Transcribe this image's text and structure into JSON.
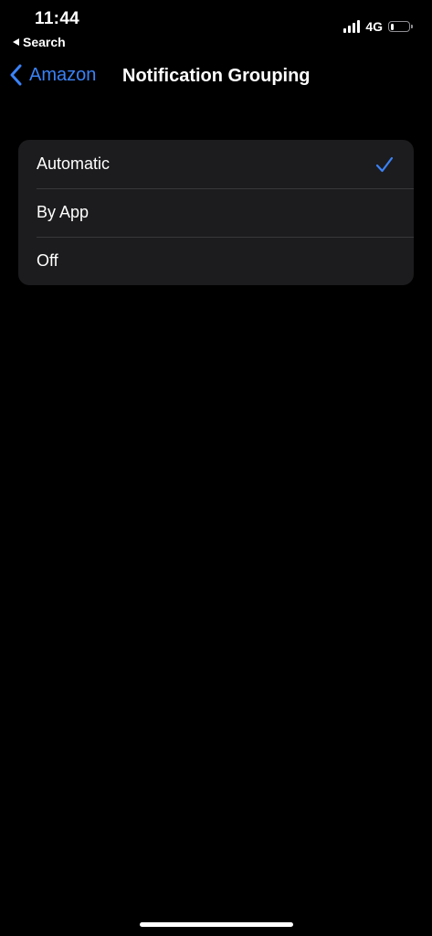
{
  "status_bar": {
    "time": "11:44",
    "back_app": "Search",
    "network": "4G",
    "signal_icon": "signal-bars-icon",
    "battery_icon": "battery-icon",
    "battery_level": 0.2
  },
  "nav": {
    "back_label": "Amazon",
    "back_icon": "chevron-left-icon",
    "title": "Notification Grouping"
  },
  "options": {
    "items": [
      {
        "label": "Automatic",
        "selected": true
      },
      {
        "label": "By App",
        "selected": false
      },
      {
        "label": "Off",
        "selected": false
      }
    ],
    "check_icon": "checkmark-icon"
  },
  "colors": {
    "background": "#000000",
    "group_background": "#1c1c1e",
    "separator": "#38383a",
    "accent": "#3a82f7",
    "text": "#ffffff"
  }
}
